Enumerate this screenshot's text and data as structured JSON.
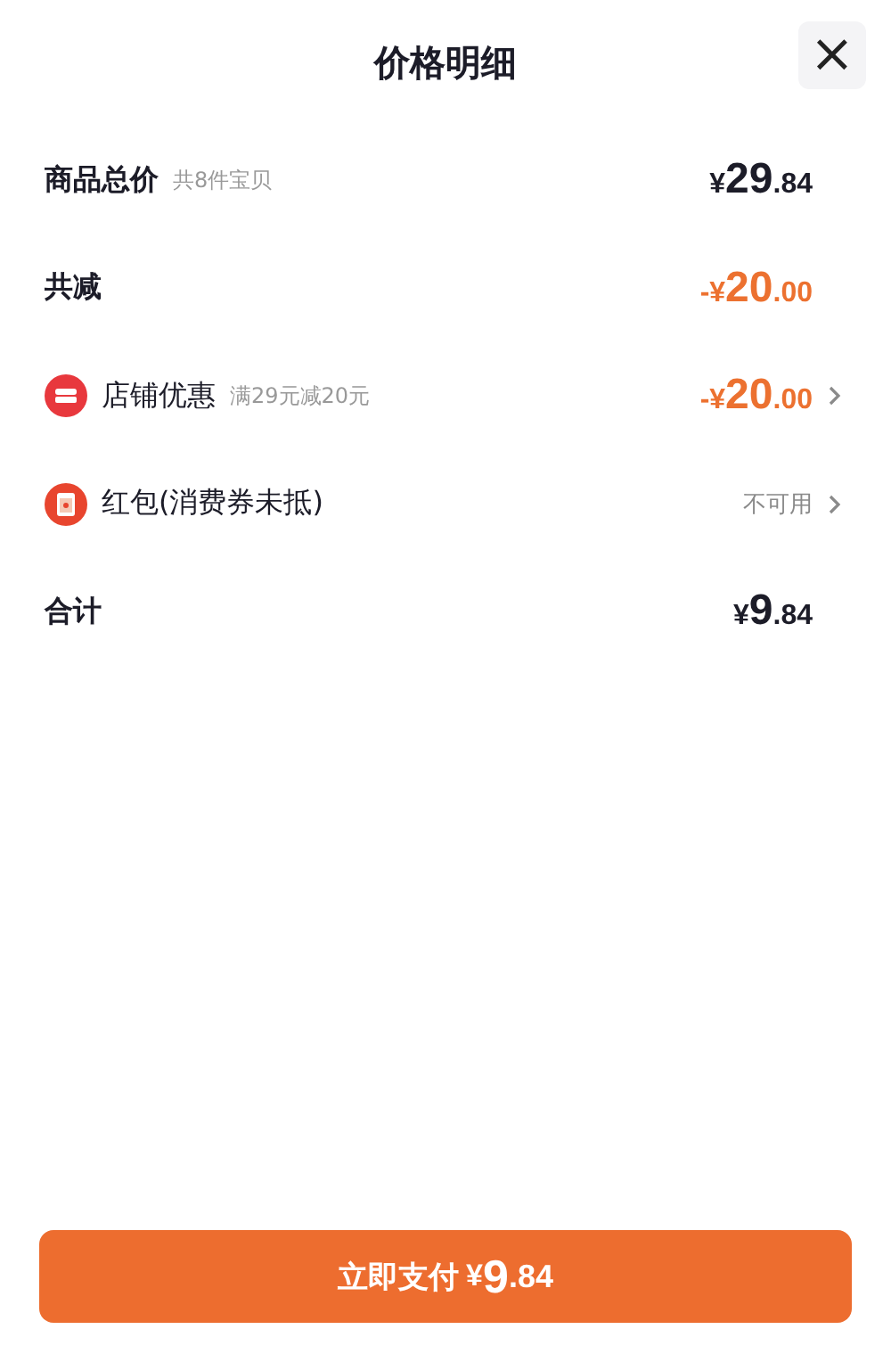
{
  "header": {
    "title": "价格明细",
    "close": "×"
  },
  "rows": [
    {
      "kind": "plain",
      "label": "商品总价",
      "note": "共8件宝贝",
      "amount": {
        "currency": "¥",
        "integer": "29",
        "decimal": ".84"
      },
      "discount": false,
      "chevron": false
    },
    {
      "kind": "plain",
      "label": "共减",
      "amount": {
        "sign": "-",
        "currency": "¥",
        "integer": "20",
        "decimal": ".00"
      },
      "discount": true,
      "chevron": false
    },
    {
      "kind": "shop",
      "label": "店铺优惠",
      "note": "满29元减20元",
      "amount": {
        "sign": "-",
        "currency": "¥",
        "integer": "20",
        "decimal": ".00"
      },
      "discount": true,
      "chevron": true
    },
    {
      "kind": "redpacket",
      "label": "红包(消费券未抵)",
      "status": "不可用",
      "chevron": true
    },
    {
      "kind": "plain",
      "label": "合计",
      "amount": {
        "currency": "¥",
        "integer": "9",
        "decimal": ".84"
      },
      "discount": false,
      "chevron": false
    }
  ],
  "pay_button": {
    "label": "立即支付",
    "amount": {
      "currency": "¥",
      "integer": "9",
      "decimal": ".84"
    }
  }
}
